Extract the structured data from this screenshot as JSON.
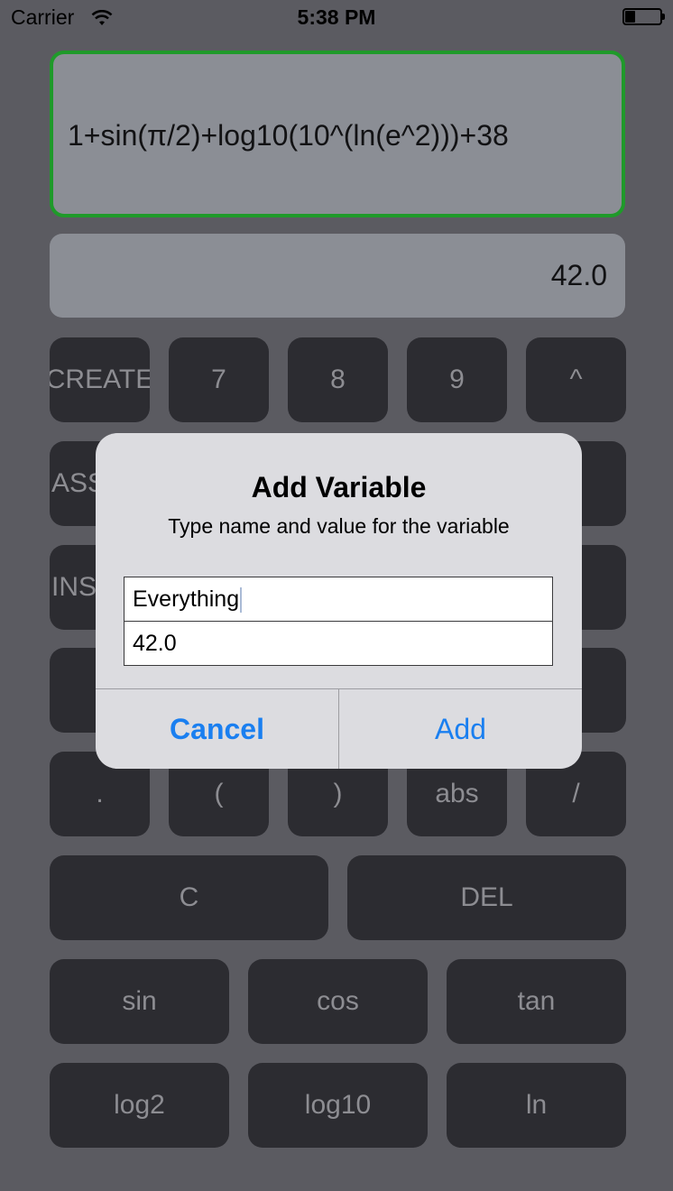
{
  "status_bar": {
    "carrier": "Carrier",
    "time": "5:38 PM",
    "battery_level": 0.3
  },
  "expression": "1+sin(π/2)+log10(10^(ln(e^2)))+38",
  "result": "42.0",
  "colors": {
    "accent": "#1f9a2a",
    "link": "#1a7ff0",
    "background": "#5b5b61",
    "key": "#2c2c31"
  },
  "keys": {
    "create": "CREATE",
    "seven": "7",
    "eight": "8",
    "nine": "9",
    "power": "^",
    "assign_partial": "ASS",
    "insert_partial": "INS",
    "dot": ".",
    "lparen": "(",
    "rparen": ")",
    "abs": "abs",
    "divide": "/",
    "clear": "C",
    "delete": "DEL",
    "sin": "sin",
    "cos": "cos",
    "tan": "tan",
    "log2": "log2",
    "log10": "log10",
    "ln": "ln"
  },
  "dialog": {
    "title": "Add Variable",
    "message": "Type name and value for the variable",
    "name_value": "Everything",
    "number_value": "42.0",
    "cancel_label": "Cancel",
    "add_label": "Add"
  }
}
